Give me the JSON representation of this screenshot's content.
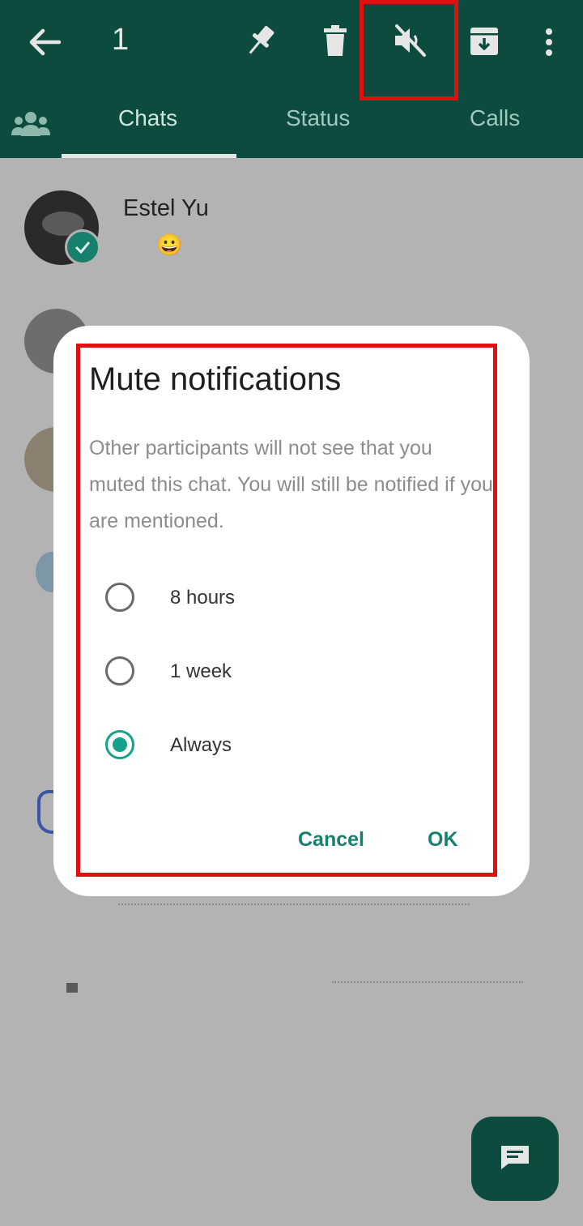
{
  "topbar": {
    "selected_count": "1",
    "icons": [
      "back-arrow-icon",
      "pin-icon",
      "delete-icon",
      "mute-icon",
      "archive-icon",
      "more-vert-icon"
    ]
  },
  "tabs": {
    "community_icon": "community-icon",
    "items": [
      {
        "label": "Chats",
        "active": true
      },
      {
        "label": "Status",
        "active": false
      },
      {
        "label": "Calls",
        "active": false
      }
    ]
  },
  "chats": {
    "first_name": "Estel Yu",
    "first_preview_emoji": "😀"
  },
  "dialog": {
    "title": "Mute notifications",
    "body": "Other participants will not see that you muted this chat. You will still be notified if you are mentioned.",
    "options": [
      {
        "label": "8 hours",
        "selected": false
      },
      {
        "label": "1 week",
        "selected": false
      },
      {
        "label": "Always",
        "selected": true
      }
    ],
    "cancel_label": "Cancel",
    "ok_label": "OK"
  },
  "colors": {
    "header": "#0d4b3f",
    "accent": "#14a38a",
    "highlight": "#e01010",
    "overlay": "#b3b3b3"
  },
  "fab": {
    "icon": "new-chat-icon"
  }
}
